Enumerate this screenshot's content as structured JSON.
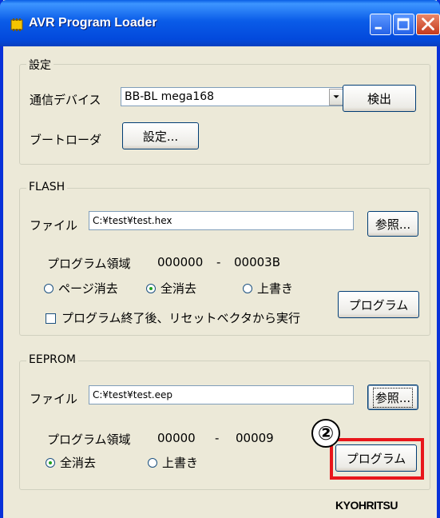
{
  "window": {
    "title": "AVR Program Loader",
    "icon": "app-chip-icon"
  },
  "settings": {
    "group_label": "設定",
    "device_label": "通信デバイス",
    "device_value": "BB-BL mega168",
    "detect_button": "検出",
    "bootloader_label": "ブートローダ",
    "bootloader_button": "設定..."
  },
  "flash": {
    "group_label": "FLASH",
    "file_label": "ファイル",
    "file_value": "C:¥test¥test.hex",
    "browse_button": "参照...",
    "region_label": "プログラム領域",
    "region_start": "000000",
    "region_sep": "-",
    "region_end": "00003B",
    "radio_options": [
      {
        "label": "ページ消去",
        "checked": false
      },
      {
        "label": "全消去",
        "checked": true
      },
      {
        "label": "上書き",
        "checked": false
      }
    ],
    "program_button": "プログラム",
    "reset_checkbox_label": "プログラム終了後、リセットベクタから実行",
    "reset_checked": false
  },
  "eeprom": {
    "group_label": "EEPROM",
    "file_label": "ファイル",
    "file_value": "C:¥test¥test.eep",
    "browse_button": "参照...",
    "region_label": "プログラム領域",
    "region_start": "00000",
    "region_sep": "-",
    "region_end": "00009",
    "radio_options": [
      {
        "label": "全消去",
        "checked": true
      },
      {
        "label": "上書き",
        "checked": false
      }
    ],
    "program_button": "プログラム"
  },
  "annotation": {
    "step_marker": "②",
    "highlight_color": "#e8161b"
  },
  "branding": {
    "logo_text": "KYOHRITSU"
  },
  "colors": {
    "titlebar": "#0a5ce8",
    "window_bg": "#ece9d8",
    "frame": "#0831d9"
  }
}
